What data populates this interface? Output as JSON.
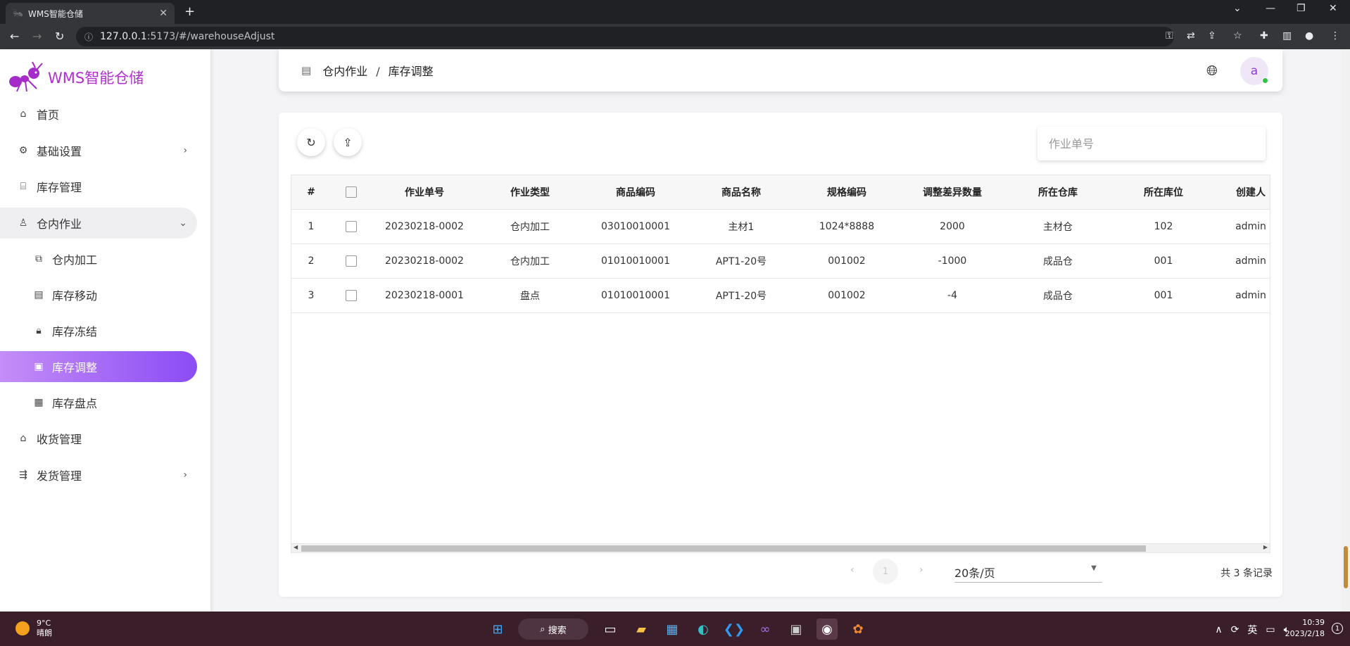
{
  "browser": {
    "tab_title": "WMS智能仓储",
    "tab_close": "✕",
    "new_tab": "+",
    "url_host": "127.0.0.1",
    "url_rest": ":5173/#/warehouseAdjust"
  },
  "sidebar": {
    "brand": "WMS智能仓储",
    "items": [
      {
        "label": "首页",
        "icon": "home-icon"
      },
      {
        "label": "基础设置",
        "icon": "gear-icon"
      },
      {
        "label": "库存管理",
        "icon": "warehouse-icon"
      },
      {
        "label": "仓内作业",
        "icon": "user-icon"
      },
      {
        "label": "仓内加工",
        "icon": "copy-icon"
      },
      {
        "label": "库存移动",
        "icon": "doc-icon"
      },
      {
        "label": "库存冻结",
        "icon": "lock-icon"
      },
      {
        "label": "库存调整",
        "icon": "doc-edit-icon"
      },
      {
        "label": "库存盘点",
        "icon": "inventory-icon"
      },
      {
        "label": "收货管理",
        "icon": "receive-icon"
      },
      {
        "label": "发货管理",
        "icon": "ship-icon"
      }
    ],
    "active_item": "库存调整",
    "accent": "#8b4cf5"
  },
  "header": {
    "breadcrumb_parent": "仓内作业",
    "breadcrumb_sep": "/",
    "breadcrumb_current": "库存调整",
    "avatar_initial": "a"
  },
  "toolbar": {
    "search_placeholder": "作业单号"
  },
  "table": {
    "columns": [
      "#",
      "",
      "作业单号",
      "作业类型",
      "商品编码",
      "商品名称",
      "规格编码",
      "调整差异数量",
      "所在仓库",
      "所在库位",
      "创建人"
    ],
    "rows": [
      [
        "1",
        "",
        "20230218-0002",
        "仓内加工",
        "03010010001",
        "主材1",
        "1024*8888",
        "2000",
        "主材仓",
        "102",
        "admin"
      ],
      [
        "2",
        "",
        "20230218-0002",
        "仓内加工",
        "01010010001",
        "APT1-20号",
        "001002",
        "-1000",
        "成品仓",
        "001",
        "admin"
      ],
      [
        "3",
        "",
        "20230218-0001",
        "盘点",
        "01010010001",
        "APT1-20号",
        "001002",
        "-4",
        "成品仓",
        "001",
        "admin"
      ]
    ]
  },
  "pagination": {
    "prev": "‹",
    "next": "›",
    "current_page": "1",
    "page_size": "20条/页",
    "total_text": "共 3 条记录"
  },
  "taskbar": {
    "temp": "9°C",
    "weather": "晴朗",
    "search_label": "搜索",
    "ime": "英",
    "time": "10:39",
    "date": "2023/2/18",
    "notifications": "1"
  }
}
